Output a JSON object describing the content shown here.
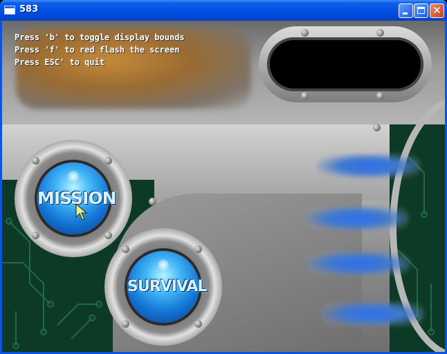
{
  "window": {
    "title": "583",
    "controls": {
      "minimize_icon": "minimize-icon",
      "maximize_icon": "maximize-icon",
      "close_icon": "close-icon",
      "close_glyph": "✕"
    }
  },
  "hud": {
    "instructions": [
      "Press 'b' to toggle display bounds",
      "Press 'f' to red flash the screen",
      "Press ESC' to quit"
    ]
  },
  "menu": {
    "mission_label": "MISSION",
    "survival_label": "SURVIVAL",
    "blurred_button_count": 4
  },
  "colors": {
    "titlebar": "#0050e6",
    "button_blue": "#1476d6",
    "circuit_green": "#0d3a26",
    "metal": "#a9a9a9"
  }
}
